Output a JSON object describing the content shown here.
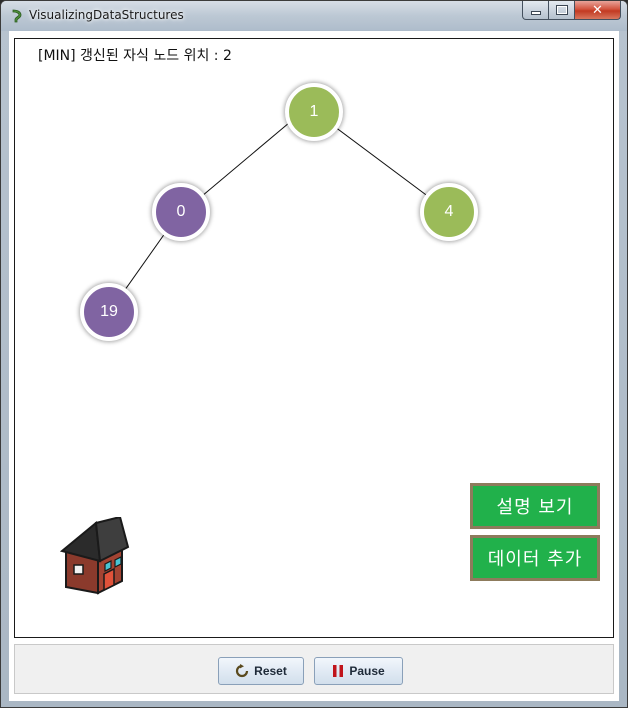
{
  "window": {
    "title": "VisualizingDataStructures",
    "controls": {
      "minimize": "minimize",
      "maximize": "maximize",
      "close": "✕"
    }
  },
  "status": "[MIN] 갱신된 자식 노드 위치 : 2",
  "tree": {
    "nodes": [
      {
        "id": "n1",
        "value": "1",
        "color": "#9bbb59"
      },
      {
        "id": "n0",
        "value": "0",
        "color": "#8064a2"
      },
      {
        "id": "n4",
        "value": "4",
        "color": "#9bbb59"
      },
      {
        "id": "n19",
        "value": "19",
        "color": "#8064a2"
      }
    ],
    "edges": [
      [
        "n1",
        "n0"
      ],
      [
        "n1",
        "n4"
      ],
      [
        "n0",
        "n19"
      ]
    ]
  },
  "buttons": {
    "show_description": "설명 보기",
    "add_data": "데이터 추가",
    "reset": "Reset",
    "pause": "Pause"
  },
  "icons": {
    "home": "house-icon",
    "reset": "refresh-icon",
    "pause": "pause-icon"
  },
  "colors": {
    "accent_green": "#21b14b",
    "node_green": "#9bbb59",
    "node_purple": "#8064a2",
    "pause_red": "#c0141b"
  }
}
